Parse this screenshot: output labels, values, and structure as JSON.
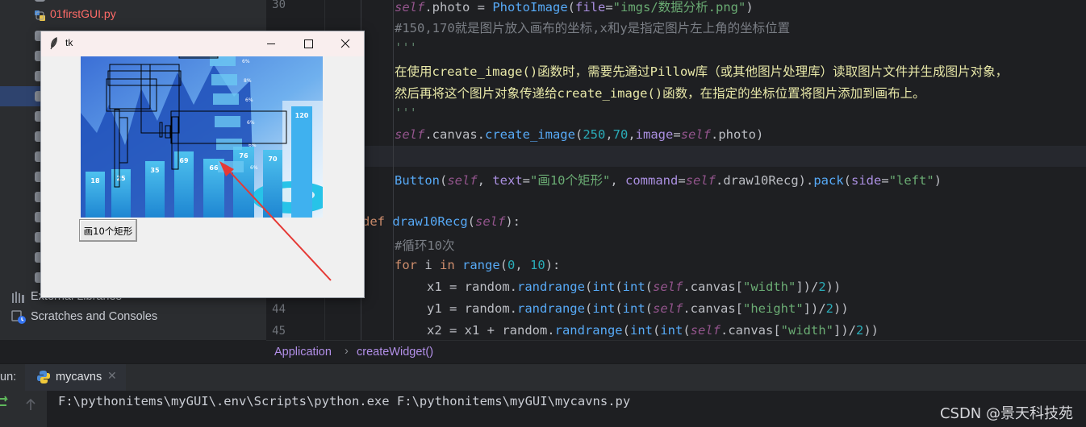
{
  "project_tree": {
    "files": [
      {
        "label": "01firstGUI.py",
        "color": "#ff6b68"
      }
    ],
    "external_libraries": "External Libraries",
    "scratches": "Scratches and Consoles"
  },
  "editor": {
    "line_numbers": [
      "30",
      "",
      "",
      "",
      "",
      "",
      "",
      "",
      "",
      "",
      "",
      "",
      "",
      "",
      "44",
      "45"
    ]
  },
  "breadcrumb": {
    "items": [
      "Application",
      "createWidget()"
    ],
    "separator": "›"
  },
  "run": {
    "label": "un:",
    "tab": "mycavns",
    "tab_close": "✕",
    "console_line": "F:\\pythonitems\\myGUI\\.env\\Scripts\\python.exe F:\\pythonitems\\myGUI\\mycavns.py"
  },
  "watermark": "CSDN @景天科技苑",
  "tk_window": {
    "title": "tk",
    "button_label": "画10个矩形",
    "chart_values": [
      "18",
      "25",
      "35",
      "69",
      "66",
      "76",
      "70",
      "120"
    ],
    "chart_percents": [
      "6%",
      "8%",
      "6%",
      "6%",
      "6%",
      "6%"
    ]
  }
}
